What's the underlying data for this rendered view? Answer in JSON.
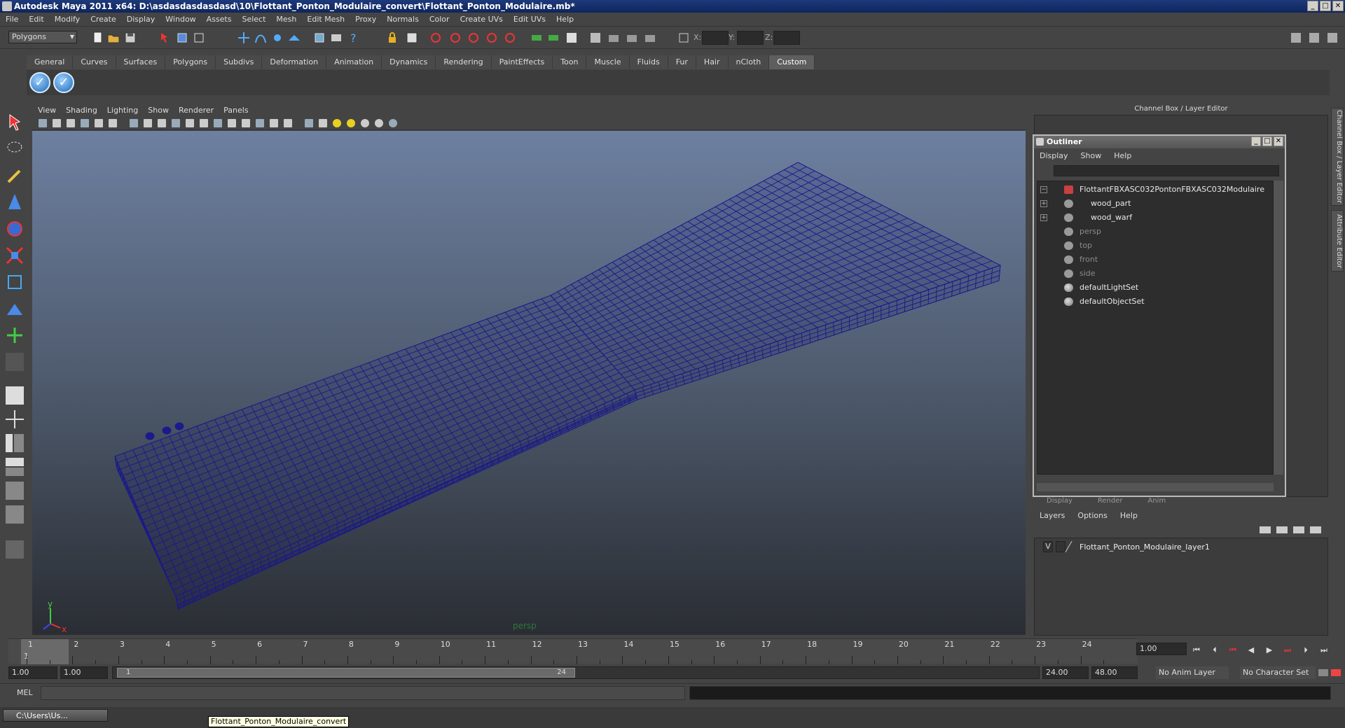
{
  "window": {
    "title": "Autodesk Maya 2011 x64: D:\\asdasdasdasdasd\\10\\Flottant_Ponton_Modulaire_convert\\Flottant_Ponton_Modulaire.mb*",
    "min": "_",
    "max": "□",
    "close": "✕"
  },
  "menubar": [
    "File",
    "Edit",
    "Modify",
    "Create",
    "Display",
    "Window",
    "Assets",
    "Select",
    "Mesh",
    "Edit Mesh",
    "Proxy",
    "Normals",
    "Color",
    "Create UVs",
    "Edit UVs",
    "Help"
  ],
  "status": {
    "mode": "Polygons",
    "x_label": "X:",
    "y_label": "Y:",
    "z_label": "Z:"
  },
  "shelf_tabs": [
    "General",
    "Curves",
    "Surfaces",
    "Polygons",
    "Subdivs",
    "Deformation",
    "Animation",
    "Dynamics",
    "Rendering",
    "PaintEffects",
    "Toon",
    "Muscle",
    "Fluids",
    "Fur",
    "Hair",
    "nCloth",
    "Custom"
  ],
  "viewport": {
    "menu": [
      "View",
      "Shading",
      "Lighting",
      "Show",
      "Renderer",
      "Panels"
    ],
    "camera": "persp",
    "axis_y": "y",
    "axis_x": "x",
    "wire_color": "#1a1a8c"
  },
  "channel_box": {
    "title": "Channel Box / Layer Editor",
    "side_tab_1": "Channel Box / Layer Editor",
    "side_tab_2": "Attribute Editor"
  },
  "outliner": {
    "title": "Outliner",
    "menu": [
      "Display",
      "Show",
      "Help"
    ],
    "rows": [
      {
        "label": "FlottantFBXASC032PontonFBXASC032Modulaire",
        "exp": "−",
        "dim": false,
        "kind": "root",
        "indent": 0
      },
      {
        "label": "wood_part",
        "exp": "+",
        "dim": false,
        "kind": "mesh",
        "indent": 1
      },
      {
        "label": "wood_warf",
        "exp": "+",
        "dim": false,
        "kind": "mesh",
        "indent": 1
      },
      {
        "label": "persp",
        "exp": "",
        "dim": true,
        "kind": "cam",
        "indent": 0
      },
      {
        "label": "top",
        "exp": "",
        "dim": true,
        "kind": "cam",
        "indent": 0
      },
      {
        "label": "front",
        "exp": "",
        "dim": true,
        "kind": "cam",
        "indent": 0
      },
      {
        "label": "side",
        "exp": "",
        "dim": true,
        "kind": "cam",
        "indent": 0
      },
      {
        "label": "defaultLightSet",
        "exp": "",
        "dim": false,
        "kind": "set",
        "indent": 0
      },
      {
        "label": "defaultObjectSet",
        "exp": "",
        "dim": false,
        "kind": "set",
        "indent": 0
      }
    ]
  },
  "layer_editor": {
    "tabs": [
      "Display",
      "Render",
      "Anim"
    ],
    "menu": [
      "Layers",
      "Options",
      "Help"
    ],
    "layer": {
      "visible": "V",
      "name": "Flottant_Ponton_Modulaire_layer1"
    }
  },
  "timeline": {
    "start_label": "1",
    "frames": [
      "1",
      "2",
      "3",
      "4",
      "5",
      "6",
      "7",
      "8",
      "9",
      "10",
      "11",
      "12",
      "13",
      "14",
      "15",
      "16",
      "17",
      "18",
      "19",
      "20",
      "21",
      "22",
      "23",
      "24"
    ],
    "current": "1.00"
  },
  "range": {
    "start": "1.00",
    "play_start": "1.00",
    "handle_start": "1",
    "handle_end": "24",
    "play_end": "24.00",
    "end": "48.00",
    "anim_layer": "No Anim Layer",
    "char_set": "No Character Set"
  },
  "command": {
    "label": "MEL"
  },
  "taskbar": {
    "window": "C:\\Users\\Us...",
    "tooltip": "Flottant_Ponton_Modulaire_convert"
  }
}
